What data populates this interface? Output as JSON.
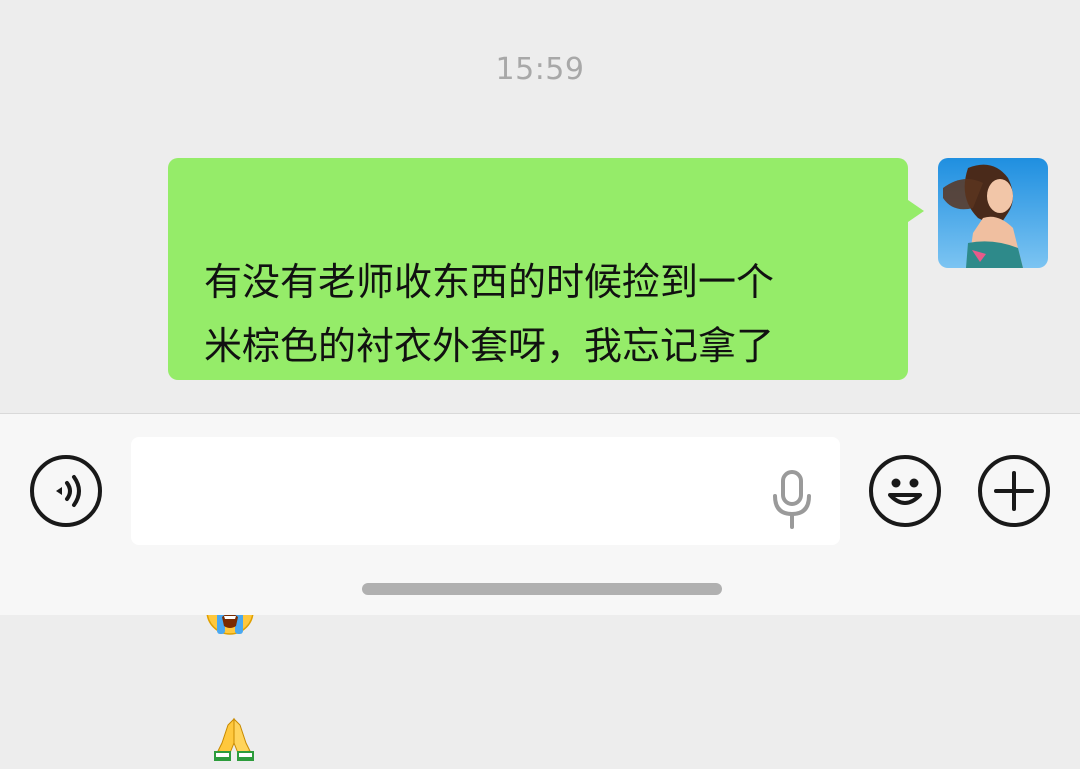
{
  "chat": {
    "timestamp": "15:59",
    "messages": [
      {
        "sender": "self",
        "text": "有没有老师收东西的时候捡到一个\n米棕色的衬衣外套呀，我忘记拿了",
        "emojis": [
          "loudly-crying-face",
          "folded-hands"
        ]
      }
    ]
  },
  "input_bar": {
    "voice_button_icon": "voice-toggle-icon",
    "input_value": "",
    "mic_icon": "microphone-icon",
    "emoji_button_icon": "smiley-icon",
    "more_button_icon": "plus-icon"
  },
  "colors": {
    "chat_background": "#ededed",
    "self_bubble": "#95ec69",
    "input_bar_background": "#f7f7f7",
    "timestamp_text": "#a8a8a8"
  }
}
